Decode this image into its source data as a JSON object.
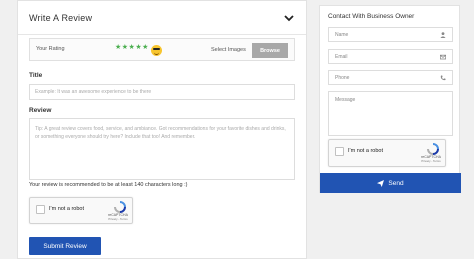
{
  "review": {
    "title": "Write A Review",
    "rating_label": "Your Rating",
    "stars": "★★★★★",
    "select_images_label": "Select Images",
    "browse_label": "Browse",
    "title_field_label": "Title",
    "title_placeholder": "Example: It was an awesome experience to be there",
    "review_field_label": "Review",
    "review_placeholder": "Tip: A great review covers food, service, and ambiance. Got recommendations for your favorite dishes and drinks, or something everyone should try here? Include that too! And remember.",
    "review_hint": "Your review is recommended to be at least 140 characters long :)",
    "submit_label": "Submit Review"
  },
  "recaptcha": {
    "label": "I'm not a robot",
    "brand": "reCAPTCHA",
    "terms": "Privacy - Terms"
  },
  "contact": {
    "title": "Contact With Business Owner",
    "name_placeholder": "Name",
    "email_placeholder": "Email",
    "phone_placeholder": "Phone",
    "message_placeholder": "Message",
    "send_label": "Send"
  },
  "colors": {
    "accent": "#2154b3",
    "star": "#4caf50",
    "browse": "#a8a8a8"
  },
  "icons": {
    "collapse": "chevron-down-icon",
    "name": "user-icon",
    "email": "envelope-icon",
    "phone": "phone-icon",
    "send": "paper-plane-icon",
    "rating": "sunglasses-emoji-icon",
    "recaptcha": "recaptcha-logo-icon"
  }
}
